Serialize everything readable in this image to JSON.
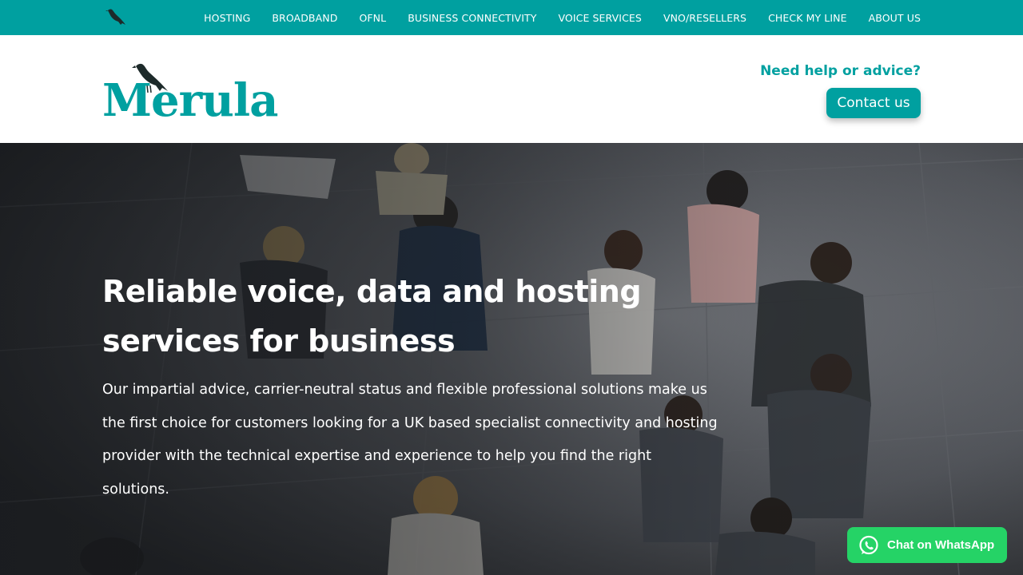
{
  "topnav": {
    "items": [
      {
        "label": "HOSTING"
      },
      {
        "label": "BROADBAND"
      },
      {
        "label": "OFNL"
      },
      {
        "label": "BUSINESS CONNECTIVITY"
      },
      {
        "label": "VOICE SERVICES"
      },
      {
        "label": "VNO/RESELLERS"
      },
      {
        "label": "CHECK MY LINE"
      },
      {
        "label": "ABOUT US"
      }
    ]
  },
  "header": {
    "logo_text": "Merula",
    "help_text": "Need help or advice?",
    "contact_label": "Contact us"
  },
  "hero": {
    "title": "Reliable voice, data and hosting services for business",
    "body": "Our impartial advice, carrier-neutral status and flexible professional solutions make us the first choice for customers looking for a UK based specialist connectivity and hosting provider with the technical expertise and experience to help you find the right solutions."
  },
  "whatsapp": {
    "label": "Chat on WhatsApp"
  },
  "colors": {
    "brand": "#00a0a0",
    "whatsapp": "#25d366"
  },
  "icons": {
    "bird": "bird-icon",
    "whatsapp": "whatsapp-icon"
  }
}
